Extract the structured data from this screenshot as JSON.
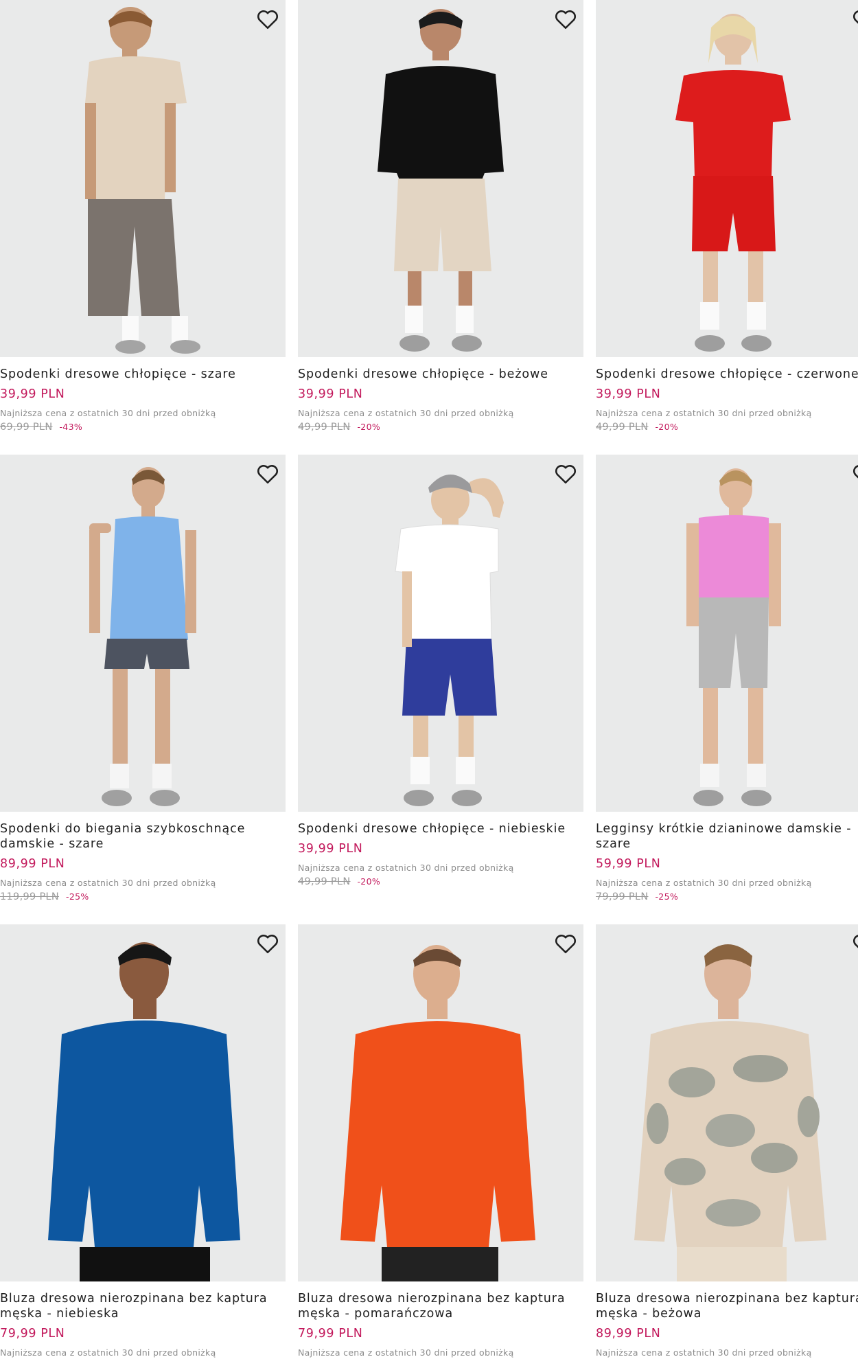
{
  "lowest_price_note": "Najniższa cena z ostatnich 30 dni przed obniżką",
  "colors": {
    "price": "#c2185b",
    "photo_background": "#e9eaea"
  },
  "products": [
    {
      "title": "Spodenki dresowe chłopięce - szare",
      "price": "39,99 PLN",
      "old_price": "69,99 PLN",
      "discount": "-43%",
      "icon": "heart-outline-icon"
    },
    {
      "title": "Spodenki dresowe chłopięce - beżowe",
      "price": "39,99 PLN",
      "old_price": "49,99 PLN",
      "discount": "-20%",
      "icon": "heart-outline-icon"
    },
    {
      "title": "Spodenki dresowe chłopięce - czerwone",
      "price": "39,99 PLN",
      "old_price": "49,99 PLN",
      "discount": "-20%",
      "icon": "heart-outline-icon"
    },
    {
      "title": "Spodenki do biegania szybkoschnące damskie - szare",
      "price": "89,99 PLN",
      "old_price": "119,99 PLN",
      "discount": "-25%",
      "icon": "heart-outline-icon"
    },
    {
      "title": "Spodenki dresowe chłopięce - niebieskie",
      "price": "39,99 PLN",
      "old_price": "49,99 PLN",
      "discount": "-20%",
      "icon": "heart-outline-icon"
    },
    {
      "title": "Legginsy krótkie dzianinowe damskie - szare",
      "price": "59,99 PLN",
      "old_price": "79,99 PLN",
      "discount": "-25%",
      "icon": "heart-outline-icon"
    },
    {
      "title": "Bluza dresowa nierozpinana bez kaptura męska - niebieska",
      "price": "79,99 PLN",
      "old_price": "",
      "discount": "",
      "icon": "heart-outline-icon"
    },
    {
      "title": "Bluza dresowa nierozpinana bez kaptura męska - pomarańczowa",
      "price": "79,99 PLN",
      "old_price": "",
      "discount": "",
      "icon": "heart-outline-icon"
    },
    {
      "title": "Bluza dresowa nierozpinana bez kaptura męska - beżowa",
      "price": "89,99 PLN",
      "old_price": "",
      "discount": "",
      "icon": "heart-outline-icon"
    }
  ]
}
